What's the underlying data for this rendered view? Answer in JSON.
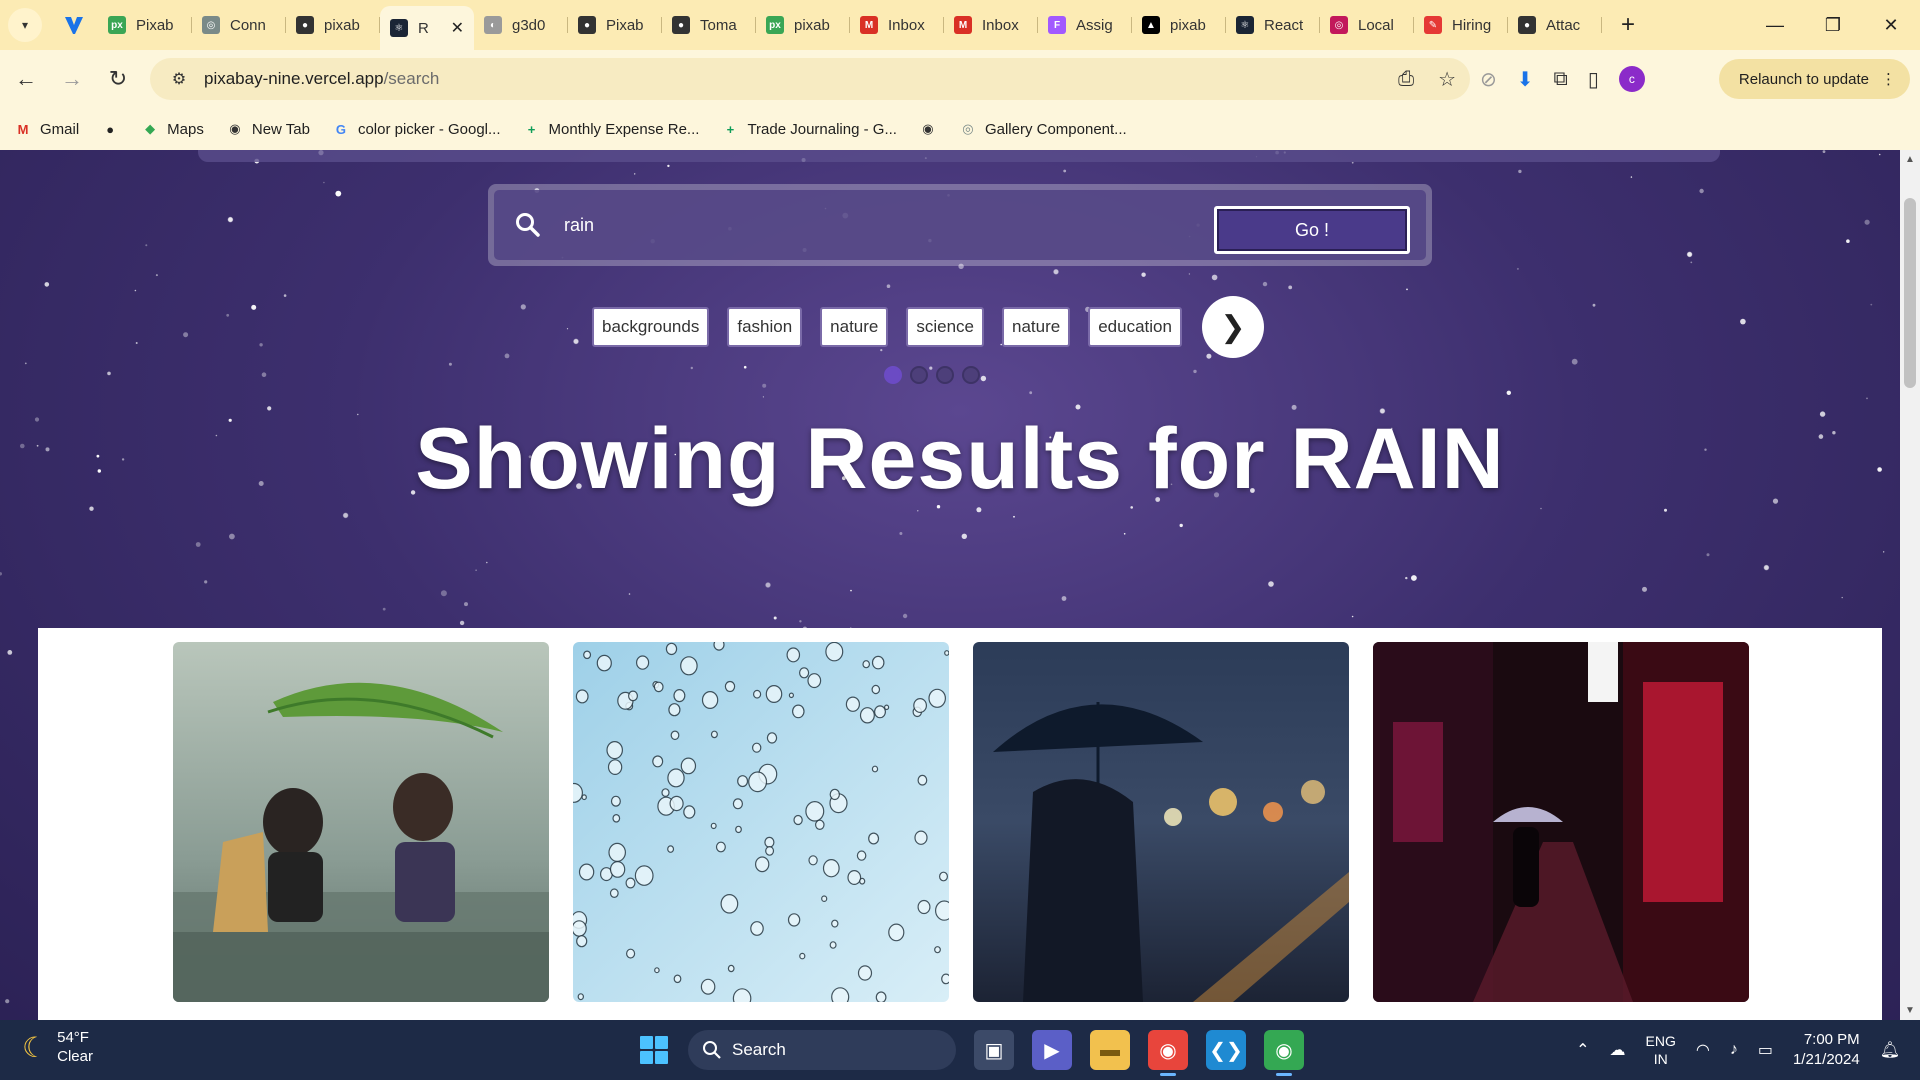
{
  "tabs": [
    {
      "label": "Pixab",
      "fav_color": "#3aa655",
      "fav_text": "px"
    },
    {
      "label": "Conn",
      "fav_color": "#7a8a88",
      "fav_text": "◎"
    },
    {
      "label": "pixab",
      "fav_color": "#333333",
      "fav_text": "●"
    },
    {
      "label": "R",
      "fav_color": "#1b2535",
      "fav_text": "⚛",
      "active": true
    },
    {
      "label": "g3d0",
      "fav_color": "#9a9a9a",
      "fav_text": "◐"
    },
    {
      "label": "Pixab",
      "fav_color": "#333333",
      "fav_text": "●"
    },
    {
      "label": "Toma",
      "fav_color": "#333333",
      "fav_text": "●"
    },
    {
      "label": "pixab",
      "fav_color": "#3aa655",
      "fav_text": "px"
    },
    {
      "label": "Inbox",
      "fav_color": "#d93025",
      "fav_text": "M"
    },
    {
      "label": "Inbox",
      "fav_color": "#d93025",
      "fav_text": "M"
    },
    {
      "label": "Assig",
      "fav_color": "#a259ff",
      "fav_text": "F"
    },
    {
      "label": "pixab",
      "fav_color": "#000000",
      "fav_text": "▲"
    },
    {
      "label": "React",
      "fav_color": "#1b2535",
      "fav_text": "⚛"
    },
    {
      "label": "Local",
      "fav_color": "#c2185b",
      "fav_text": "◎"
    },
    {
      "label": "Hiring",
      "fav_color": "#e53935",
      "fav_text": "✎"
    },
    {
      "label": "Attac",
      "fav_color": "#333333",
      "fav_text": "●"
    }
  ],
  "toolbar": {
    "url_host": "pixabay-nine.vercel.app",
    "url_path": "/search",
    "relaunch_label": "Relaunch to update",
    "profile_initial": "c"
  },
  "bookmarks": [
    {
      "label": "Gmail",
      "icon": "M",
      "color": "#d93025"
    },
    {
      "label": "",
      "icon": "●",
      "color": "#222222"
    },
    {
      "label": "Maps",
      "icon": "◆",
      "color": "#34a853"
    },
    {
      "label": "New Tab",
      "icon": "◉",
      "color": "#333333"
    },
    {
      "label": "color picker - Googl...",
      "icon": "G",
      "color": "#4285f4"
    },
    {
      "label": "Monthly Expense Re...",
      "icon": "+",
      "color": "#0f9d58"
    },
    {
      "label": "Trade Journaling - G...",
      "icon": "+",
      "color": "#0f9d58"
    },
    {
      "label": "",
      "icon": "◉",
      "color": "#333333"
    },
    {
      "label": "Gallery Component...",
      "icon": "◎",
      "color": "#7a8a88"
    }
  ],
  "search": {
    "query": "rain",
    "go_label": "Go !"
  },
  "chips": [
    "backgrounds",
    "fashion",
    "nature",
    "science",
    "nature",
    "education"
  ],
  "chips_next": "❯",
  "results": {
    "title": "Showing Results for RAIN"
  },
  "taskbar": {
    "temp": "54°F",
    "condition": "Clear",
    "search_label": "Search",
    "lang_1": "ENG",
    "lang_2": "IN",
    "time": "7:00 PM",
    "date": "1/21/2024"
  }
}
